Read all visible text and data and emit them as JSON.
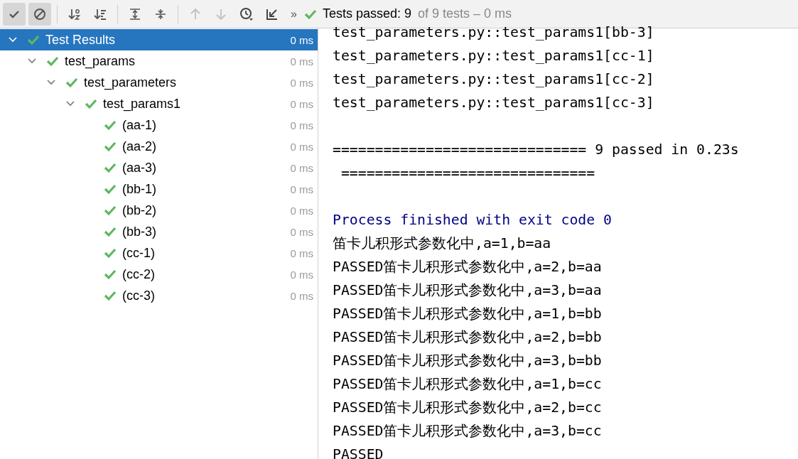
{
  "toolbar": {
    "buttons": [
      {
        "kind": "check",
        "selected": true
      },
      {
        "kind": "stop",
        "selected": true
      },
      {
        "kind": "sep"
      },
      {
        "kind": "sort-alpha",
        "selected": false
      },
      {
        "kind": "sort-duration",
        "selected": false
      },
      {
        "kind": "sep"
      },
      {
        "kind": "expand",
        "selected": false
      },
      {
        "kind": "collapse",
        "selected": false
      },
      {
        "kind": "sep"
      },
      {
        "kind": "up",
        "selected": false,
        "disabled": true
      },
      {
        "kind": "down",
        "selected": false,
        "disabled": true
      },
      {
        "kind": "history",
        "selected": false
      },
      {
        "kind": "import",
        "selected": false
      }
    ],
    "more": "»",
    "status": "Tests passed: 9",
    "status_detail": "of 9 tests – 0 ms"
  },
  "tree": [
    {
      "label": "Test Results",
      "time": "0 ms",
      "selected": true,
      "expanded": true,
      "children": [
        {
          "label": "test_params",
          "time": "0 ms",
          "selected": false,
          "expanded": true,
          "children": [
            {
              "label": "test_parameters",
              "time": "0 ms",
              "selected": false,
              "expanded": true,
              "children": [
                {
                  "label": "test_params1",
                  "time": "0 ms",
                  "selected": false,
                  "expanded": true,
                  "children": [
                    {
                      "label": "(aa-1)",
                      "time": "0 ms",
                      "selected": false
                    },
                    {
                      "label": "(aa-2)",
                      "time": "0 ms",
                      "selected": false
                    },
                    {
                      "label": "(aa-3)",
                      "time": "0 ms",
                      "selected": false
                    },
                    {
                      "label": "(bb-1)",
                      "time": "0 ms",
                      "selected": false
                    },
                    {
                      "label": "(bb-2)",
                      "time": "0 ms",
                      "selected": false
                    },
                    {
                      "label": "(bb-3)",
                      "time": "0 ms",
                      "selected": false
                    },
                    {
                      "label": "(cc-1)",
                      "time": "0 ms",
                      "selected": false
                    },
                    {
                      "label": "(cc-2)",
                      "time": "0 ms",
                      "selected": false
                    },
                    {
                      "label": "(cc-3)",
                      "time": "0 ms",
                      "selected": false
                    }
                  ]
                }
              ]
            }
          ]
        }
      ]
    }
  ],
  "console": [
    {
      "kind": "text",
      "text": "test_parameters.py::test_params1[bb-3]"
    },
    {
      "kind": "text",
      "text": "test_parameters.py::test_params1[cc-1]"
    },
    {
      "kind": "text",
      "text": "test_parameters.py::test_params1[cc-2]"
    },
    {
      "kind": "text",
      "text": "test_parameters.py::test_params1[cc-3]"
    },
    {
      "kind": "blank"
    },
    {
      "kind": "text",
      "text": "============================== 9 passed in 0.23s"
    },
    {
      "kind": "text",
      "text": " =============================="
    },
    {
      "kind": "blank"
    },
    {
      "kind": "system",
      "text": "Process finished with exit code 0"
    },
    {
      "kind": "text",
      "text": "笛卡儿积形式参数化中,a=1,b=aa"
    },
    {
      "kind": "text",
      "text": "PASSED笛卡儿积形式参数化中,a=2,b=aa"
    },
    {
      "kind": "text",
      "text": "PASSED笛卡儿积形式参数化中,a=3,b=aa"
    },
    {
      "kind": "text",
      "text": "PASSED笛卡儿积形式参数化中,a=1,b=bb"
    },
    {
      "kind": "text",
      "text": "PASSED笛卡儿积形式参数化中,a=2,b=bb"
    },
    {
      "kind": "text",
      "text": "PASSED笛卡儿积形式参数化中,a=3,b=bb"
    },
    {
      "kind": "text",
      "text": "PASSED笛卡儿积形式参数化中,a=1,b=cc"
    },
    {
      "kind": "text",
      "text": "PASSED笛卡儿积形式参数化中,a=2,b=cc"
    },
    {
      "kind": "text",
      "text": "PASSED笛卡儿积形式参数化中,a=3,b=cc"
    },
    {
      "kind": "text",
      "text": "PASSED"
    }
  ]
}
